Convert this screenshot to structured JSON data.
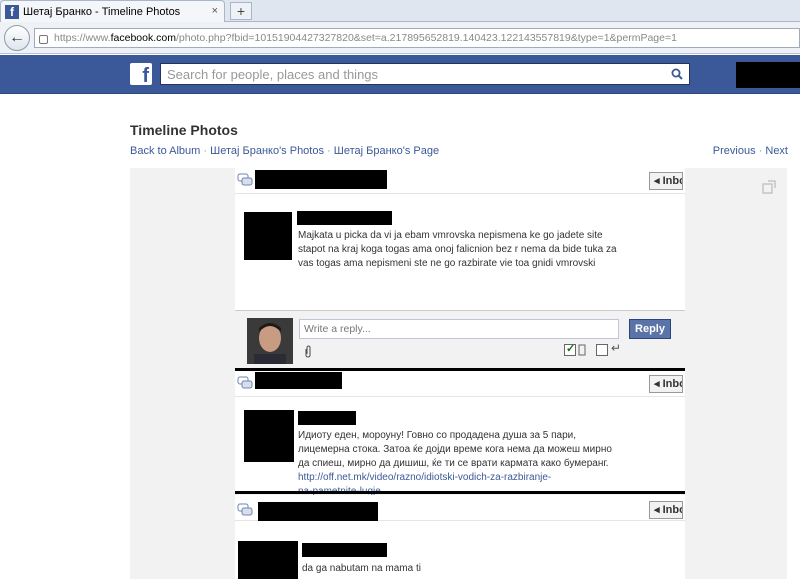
{
  "browser": {
    "tab_title": "Шетај Бранко - Timeline Photos",
    "favicon_letter": "f",
    "tab_close": "×",
    "new_tab": "+",
    "back": "←",
    "url_prefix": "https://www.",
    "url_host": "facebook.com",
    "url_rest": "/photo.php?fbid=10151904427327820&set=a.217895652819.140423.122143557819&type=1&permPage=1"
  },
  "fb": {
    "logo_letter": "f",
    "search_placeholder": "Search for people, places and things"
  },
  "page": {
    "title": "Timeline Photos",
    "breadcrumbs": [
      "Back to Album",
      "Шетај Бранко's Photos",
      "Шетај Бранко's Page"
    ],
    "separator": "·",
    "previous": "Previous",
    "next": "Next"
  },
  "messages": [
    {
      "inbox_label": "Inbox",
      "text_lines": [
        "Majkata u picka da vi ja ebam vmrovska nepismena ke go jadete site",
        "stapot na kraj koga togas ama onoj falicnion bez r nema da bide tuka za",
        "vas togas ama nepismeni ste ne go razbirate vie toa gnidi vmrovski"
      ]
    },
    {
      "inbox_label": "Inbox",
      "text_lines": [
        "Идиоту еден, мороуну! Говно со продадена душа за 5 пари,",
        "лицемерна стока. Затоа ќе дојди време кога нема да можеш мирно",
        "да спиеш, мирно да дишиш, ќе ти се врати кармата како бумеранг."
      ],
      "link_lines": [
        "http://off.net.mk/video/razno/idiotski-vodich-za-razbiranje-",
        "na-pametnite-lugje"
      ]
    },
    {
      "inbox_label": "Inbox",
      "text_lines": [
        "da ga nabutam na mama ti"
      ]
    }
  ],
  "reply": {
    "placeholder": "Write a reply...",
    "button_label": "Reply",
    "enter_to_send_checked": true,
    "return_arrow": "↵"
  },
  "colors": {
    "fb_blue": "#3b5998",
    "reply_button": "#5b74a8"
  }
}
